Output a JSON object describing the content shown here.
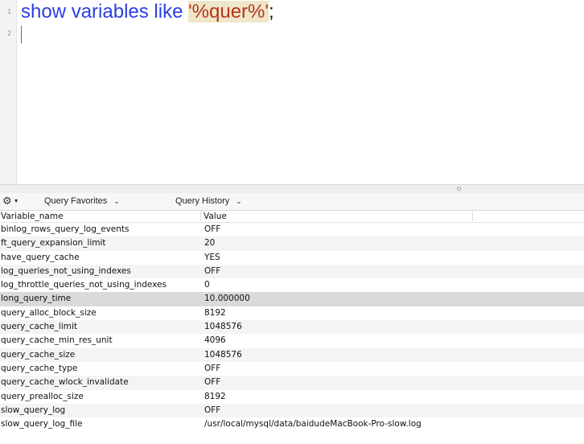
{
  "editor": {
    "line_numbers": [
      "1",
      "2"
    ],
    "query": {
      "keyword": "show variables like",
      "string": "'%quer%'",
      "terminator": ";"
    }
  },
  "toolbar": {
    "gear_icon": "gear-icon",
    "favorites_label": "Query Favorites",
    "history_label": "Query History"
  },
  "table": {
    "columns": [
      "Variable_name",
      "Value"
    ],
    "selected_row": 5,
    "rows": [
      {
        "name": "binlog_rows_query_log_events",
        "value": "OFF"
      },
      {
        "name": "ft_query_expansion_limit",
        "value": "20"
      },
      {
        "name": "have_query_cache",
        "value": "YES"
      },
      {
        "name": "log_queries_not_using_indexes",
        "value": "OFF"
      },
      {
        "name": "log_throttle_queries_not_using_indexes",
        "value": "0"
      },
      {
        "name": "long_query_time",
        "value": "10.000000"
      },
      {
        "name": "query_alloc_block_size",
        "value": "8192"
      },
      {
        "name": "query_cache_limit",
        "value": "1048576"
      },
      {
        "name": "query_cache_min_res_unit",
        "value": "4096"
      },
      {
        "name": "query_cache_size",
        "value": "1048576"
      },
      {
        "name": "query_cache_type",
        "value": "OFF"
      },
      {
        "name": "query_cache_wlock_invalidate",
        "value": "OFF"
      },
      {
        "name": "query_prealloc_size",
        "value": "8192"
      },
      {
        "name": "slow_query_log",
        "value": "OFF"
      },
      {
        "name": "slow_query_log_file",
        "value": "/usr/local/mysql/data/baidudeMacBook-Pro-slow.log"
      }
    ]
  }
}
